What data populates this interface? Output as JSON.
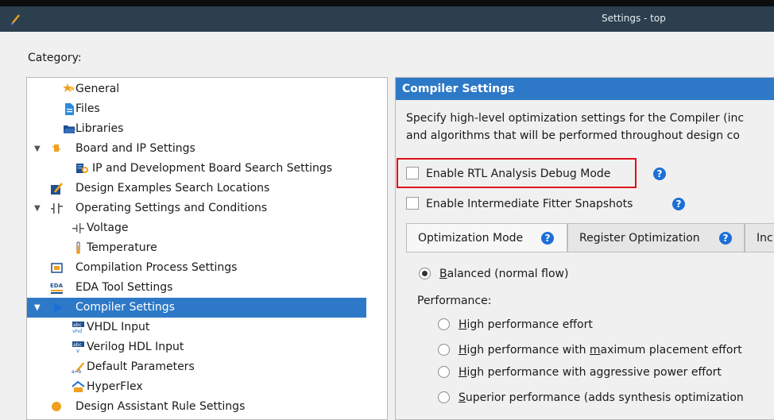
{
  "window": {
    "title": "Settings - top"
  },
  "category_label": "Category:",
  "tree": [
    {
      "label": "General",
      "icon": "star-icon"
    },
    {
      "label": "Files",
      "icon": "file-icon"
    },
    {
      "label": "Libraries",
      "icon": "folder-icon"
    },
    {
      "label": "Board and IP Settings",
      "icon": "board-ip-icon",
      "expanded": true
    },
    {
      "label": "IP and Development Board Search Settings",
      "icon": "ip-search-icon"
    },
    {
      "label": "Design Examples Search Locations",
      "icon": "design-examples-icon"
    },
    {
      "label": "Operating Settings and Conditions",
      "icon": "operating-conditions-icon",
      "expanded": true
    },
    {
      "label": "Voltage",
      "icon": "voltage-icon"
    },
    {
      "label": "Temperature",
      "icon": "thermometer-icon"
    },
    {
      "label": "Compilation Process Settings",
      "icon": "compilation-process-icon"
    },
    {
      "label": "EDA Tool Settings",
      "icon": "eda-icon"
    },
    {
      "label": "Compiler Settings",
      "icon": "play-icon",
      "expanded": true,
      "selected": true
    },
    {
      "label": "VHDL Input",
      "icon": "vhdl-icon"
    },
    {
      "label": "Verilog HDL Input",
      "icon": "verilog-icon"
    },
    {
      "label": "Default Parameters",
      "icon": "parameters-icon"
    },
    {
      "label": "HyperFlex",
      "icon": "hyperflex-icon"
    },
    {
      "label": "Design Assistant Rule Settings",
      "icon": "design-assistant-icon"
    }
  ],
  "panel": {
    "header": "Compiler Settings",
    "desc_line1": "Specify high-level optimization settings for the Compiler (inc",
    "desc_line2": "and algorithms that will be performed throughout design co",
    "checkbox_rtl": "Enable RTL Analysis Debug Mode",
    "checkbox_fitter": "Enable Intermediate Fitter Snapshots",
    "tabs": [
      "Optimization Mode",
      "Register Optimization",
      "Inc"
    ],
    "balanced_prefix": "B",
    "balanced_rest": "alanced (normal flow)",
    "performance_label": "Performance:",
    "perf_opt1_u": "H",
    "perf_opt1_rest": "igh performance effort",
    "perf_opt2_u": "H",
    "perf_opt2_mid": "igh performance with ",
    "perf_opt2_u2": "m",
    "perf_opt2_rest": "aximum placement effort",
    "perf_opt3_u": "H",
    "perf_opt3_rest": "igh performance with aggressive power effort",
    "perf_opt4_u": "S",
    "perf_opt4_rest": "uperior performance (adds synthesis optimization"
  },
  "colors": {
    "selection": "#2d79c7",
    "titlebar": "#2b3f4e",
    "highlight": "#e0101b",
    "help": "#1d6fd6"
  }
}
